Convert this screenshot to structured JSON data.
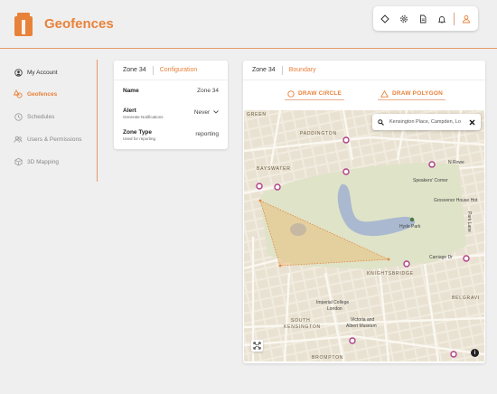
{
  "header": {
    "title": "Geofences",
    "toolbar": [
      "pin-diamond-icon",
      "settings-icon",
      "document-icon",
      "bell-icon",
      "user-icon"
    ]
  },
  "sidebar": {
    "items": [
      {
        "label": "My Account",
        "icon": "user-circle-icon"
      },
      {
        "label": "Geofences",
        "icon": "shapes-icon"
      },
      {
        "label": "Schedules",
        "icon": "clock-icon"
      },
      {
        "label": "Users & Permissions",
        "icon": "users-icon"
      },
      {
        "label": "3D Mapping",
        "icon": "cube-icon"
      }
    ]
  },
  "config_card": {
    "zone": "Zone 34",
    "tab": "Configuration",
    "name_label": "Name",
    "name_value": "Zone 34",
    "alert_label": "Alert",
    "alert_sub": "Generate Notifications",
    "alert_value": "Never",
    "type_label": "Zone Type",
    "type_sub": "Used for reporting",
    "type_value": "reporting"
  },
  "boundary_card": {
    "zone": "Zone 34",
    "tab": "Boundary",
    "draw_circle": "DRAW CIRCLE",
    "draw_polygon": "DRAW POLYGON"
  },
  "map": {
    "search_value": "Kensington Place, Campden, Lo",
    "labels": {
      "green": "GREEN",
      "paddington": "PADDINGTON",
      "bayswater": "BAYSWATER",
      "knightsbridge": "KNIGHTSBRIDGE",
      "south_kensington_1": "SOUTH",
      "south_kensington_2": "KENSINGTON",
      "brompton": "BROMPTON",
      "belgravia": "BELGRAVI",
      "speakers": "Speakers' Corner",
      "grosvenor": "Grosvenor House Hot",
      "hyde_park": "Hyde Park",
      "imperial_1": "Imperial College",
      "imperial_2": "London",
      "va_1": "Victoria and",
      "va_2": "Albert Museum",
      "carriage": "Carriage Dr",
      "park_lane": "Park Lane",
      "w_rowe": "N Rowe"
    },
    "colors": {
      "park": "#dfe3c8",
      "water": "#aab8d0",
      "polygon": "#e8b86a",
      "accent": "#e8823a"
    }
  }
}
